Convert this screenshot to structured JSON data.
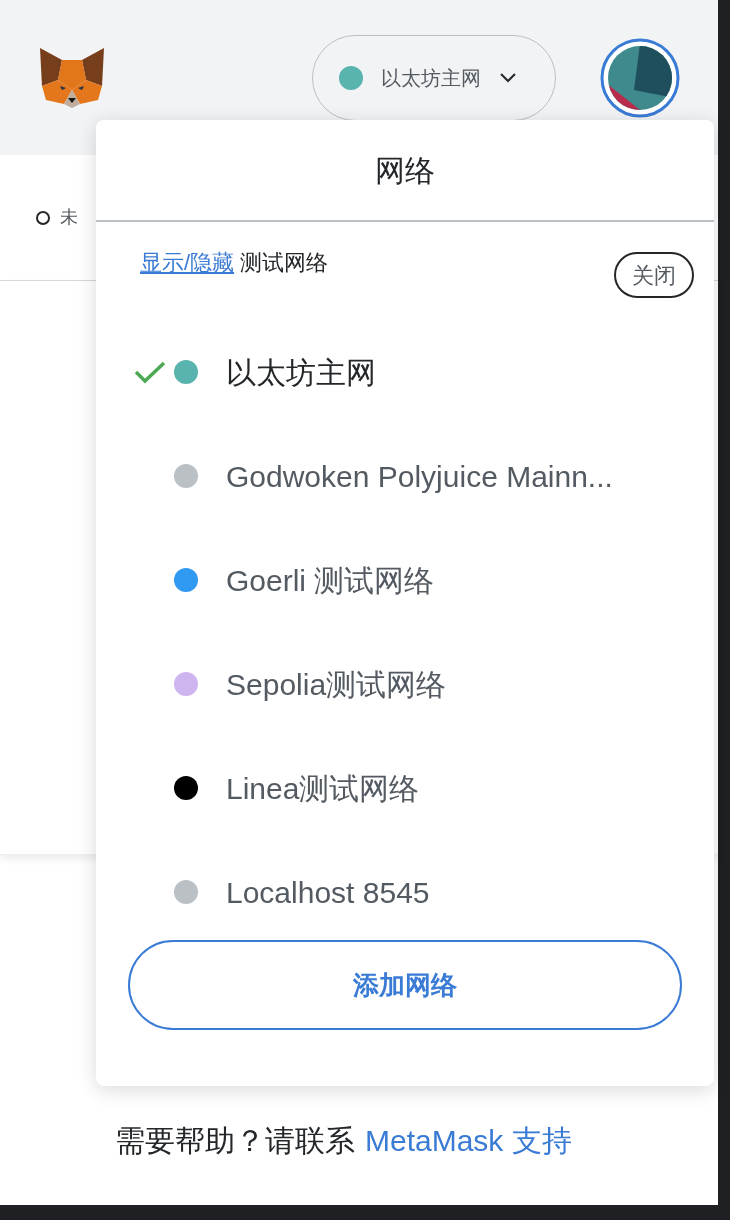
{
  "header": {
    "network_selector": {
      "label": "以太坊主网",
      "color": "#59b3ae"
    }
  },
  "status": {
    "label": "未"
  },
  "modal": {
    "title": "网络",
    "toggle_link": "显示/隐藏",
    "toggle_text": "测试网络",
    "close_button": "关闭",
    "networks": [
      {
        "name": "以太坊主网",
        "color": "#59b3ae",
        "selected": true
      },
      {
        "name": "Godwoken Polyjuice Mainn...",
        "color": "#bbc0c5",
        "selected": false
      },
      {
        "name": "Goerli 测试网络",
        "color": "#3099f2",
        "selected": false
      },
      {
        "name": "Sepolia测试网络",
        "color": "#cfb5f0",
        "selected": false
      },
      {
        "name": "Linea测试网络",
        "color": "#000000",
        "selected": false
      },
      {
        "name": "Localhost 8545",
        "color": "#bbc0c5",
        "selected": false
      }
    ],
    "add_button": "添加网络"
  },
  "footer": {
    "text": "需要帮助？请联系",
    "link": "MetaMask 支持"
  }
}
